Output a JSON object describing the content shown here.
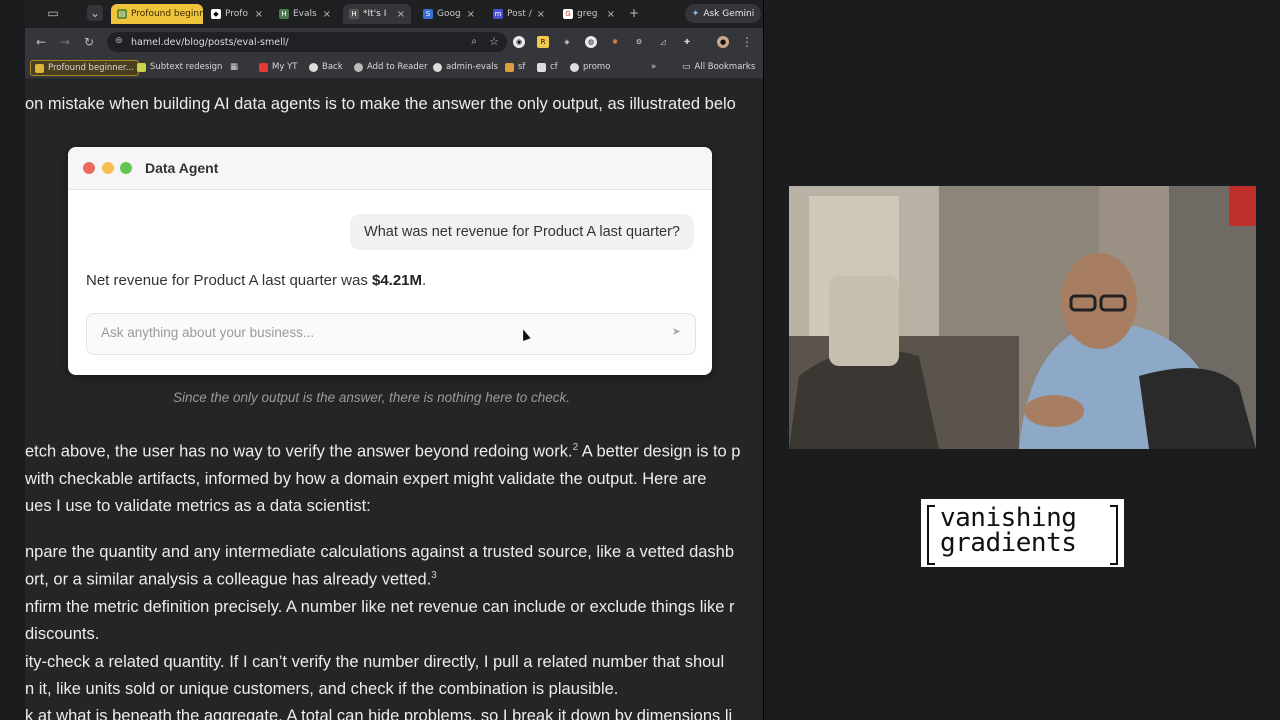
{
  "browser": {
    "tabs": [
      {
        "label": "Profound beginner",
        "style": "highlight"
      },
      {
        "label": "Profo",
        "style": "normal"
      },
      {
        "label": "Evals",
        "style": "normal"
      },
      {
        "label": "*It's I",
        "style": "active"
      },
      {
        "label": "Goog",
        "style": "normal"
      },
      {
        "label": "Post /",
        "style": "normal"
      },
      {
        "label": "greg",
        "style": "normal"
      }
    ],
    "new_tab_label": "+",
    "ask_gemini": "Ask Gemini",
    "url": "hamel.dev/blog/posts/eval-smell/",
    "bookmarks": [
      "Profound beginner...",
      "Subtext redesign",
      "My YT",
      "Back",
      "Add to Reader",
      "admin-evals",
      "sf",
      "cf",
      "promo"
    ],
    "bookmarks_overflow": "»",
    "all_bookmarks": "All Bookmarks"
  },
  "article": {
    "intro_line": "on mistake when building AI data agents is to make the answer the only output, as illustrated belo",
    "caption": "Since the only output is the answer, there is nothing here to check.",
    "para1": [
      {
        "text": "etch above, the user has no way to verify the answer beyond redoing work.",
        "sup": "2",
        "tail": " A better design is to p"
      },
      {
        "text": " with checkable artifacts, informed by how a domain expert might validate the output. Here are",
        "sup": "",
        "tail": ""
      },
      {
        "text": "ues I use to validate metrics as a data scientist:",
        "sup": "",
        "tail": ""
      }
    ],
    "list_lines": [
      {
        "text": "npare the quantity and any intermediate calculations against a trusted source, like a vetted dashb",
        "sup": "",
        "tail": ""
      },
      {
        "text": "ort, or a similar analysis a colleague has already vetted.",
        "sup": "3",
        "tail": ""
      },
      {
        "text": "nfirm the metric definition precisely. A number like net revenue can include or exclude things like r",
        "sup": "",
        "tail": ""
      },
      {
        "text": " discounts.",
        "sup": "",
        "tail": ""
      },
      {
        "text": "ity-check a related quantity. If I can’t verify the number directly, I pull a related number that shoul",
        "sup": "",
        "tail": ""
      },
      {
        "text": "n it, like units sold or unique customers, and check if the combination is plausible.",
        "sup": "",
        "tail": ""
      },
      {
        "text": "k at what is beneath the aggregate. A total can hide problems, so I break it down by dimensions li",
        "sup": "",
        "tail": ""
      }
    ]
  },
  "agent_card": {
    "title": "Data Agent",
    "user_message": "What was net revenue for Product A last quarter?",
    "answer_prefix": "Net revenue for Product A last quarter was ",
    "answer_value": "$4.21M",
    "answer_suffix": ".",
    "input_placeholder": "Ask anything about your business...",
    "send_icon": "➤"
  },
  "logo": {
    "line1": "vanishing",
    "line2": "gradients"
  },
  "colors": {
    "traffic_red": "#ee6a5f",
    "traffic_yellow": "#f5be4f",
    "traffic_green": "#62c554",
    "highlight_tab": "#f0c33c"
  }
}
